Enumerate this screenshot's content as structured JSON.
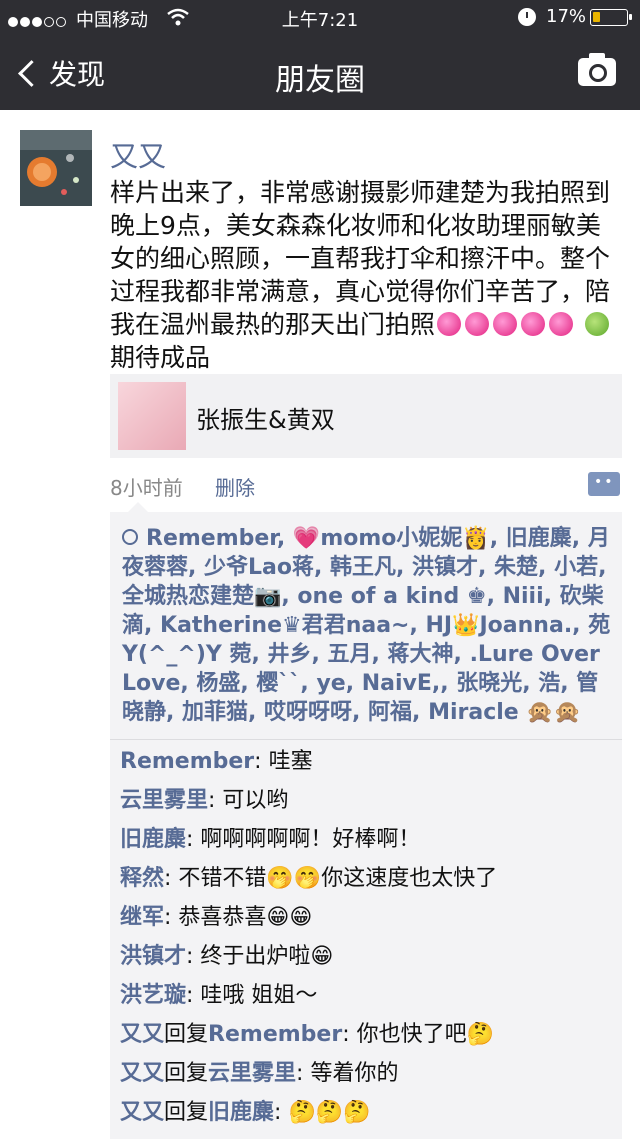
{
  "status_bar": {
    "carrier": "中国移动",
    "time": "上午7:21",
    "battery": "17%"
  },
  "nav": {
    "back_label": "发现",
    "title": "朋友圈"
  },
  "post": {
    "author": "又又",
    "text": "样片出来了，非常感谢摄影师建楚为我拍照到晚上9点，美女森森化妆师和化妆助理丽敏美女的细心照顾，一直帮我打伞和擦汗中。整个过程我都非常满意，真心觉得你们辛苦了，陪我在温州最热的那天出门拍照",
    "text_end": "期待成品",
    "share_title": "张振生&黄双",
    "time": "8小时前",
    "delete_label": "删除"
  },
  "likes": "Remember, 💗momo小妮妮👸, 旧鹿麋, 月夜蓉蓉, 少爷Lao蒋, 韩王凡, 洪镇才, 朱楚, 小若, 全城热恋建楚📷, one of a kind ♚, Niii, 砍柴滴, Katherine♛君君naa~, HJ👑Joanna., 苑 Y(^_^)Y 菀, 井乡, 五月, 蒋大神, .Lure Over Love, 杨盛, 樱``, ye, NaivE,, 张晓光, 浩, 管晓静, 加菲猫, 哎呀呀呀, 阿福, Miracle 🙊🙊",
  "comments": [
    {
      "author": "Remember",
      "reply_to": "",
      "text": "哇塞"
    },
    {
      "author": "云里雾里",
      "reply_to": "",
      "text": "可以哟"
    },
    {
      "author": "旧鹿麋",
      "reply_to": "",
      "text": "啊啊啊啊啊！好棒啊！"
    },
    {
      "author": "释然",
      "reply_to": "",
      "text": "不错不错🤭🤭你这速度也太快了"
    },
    {
      "author": "继军",
      "reply_to": "",
      "text": "恭喜恭喜😁😁"
    },
    {
      "author": "洪镇才",
      "reply_to": "",
      "text": "终于出炉啦😁"
    },
    {
      "author": "洪艺璇",
      "reply_to": "",
      "text": "哇哦 姐姐～"
    },
    {
      "author": "又又",
      "reply_to": "Remember",
      "text": "你也快了吧🤔"
    },
    {
      "author": "又又",
      "reply_to": "云里雾里",
      "text": "等着你的"
    },
    {
      "author": "又又",
      "reply_to": "旧鹿麋",
      "text": "🤔🤔🤔"
    }
  ],
  "reply_word": "回复"
}
